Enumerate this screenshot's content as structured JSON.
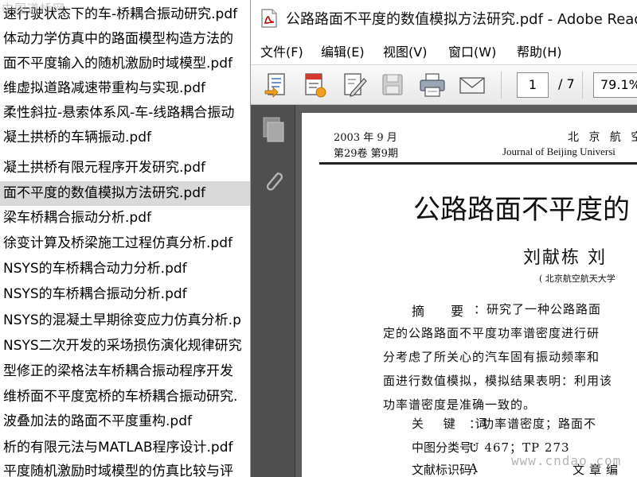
{
  "watermark_top_left": "中国道桥网",
  "watermark_bottom_right": "www.cndao.com",
  "file_list": {
    "items": [
      "速行驶状态下的车-桥耦合振动研究.pdf",
      "体动力学仿真中的路面模型构造方法的",
      "面不平度输入的随机激励时域模型.pdf",
      "维虚拟道路减速带重构与实现.pdf",
      "柔性斜拉-悬索体系风-车-线路耦合振动",
      "凝土拱桥的车辆振动.pdf",
      "凝土拱桥有限元程序开发研究.pdf",
      "面不平度的数值模拟方法研究.pdf",
      "梁车桥耦合振动分析.pdf",
      "徐变计算及桥梁施工过程仿真分析.pdf",
      "NSYS的车桥耦合动力分析.pdf",
      "NSYS的车桥耦合振动分析.pdf",
      "NSYS的混凝土早期徐变应力仿真分析.p",
      "NSYS二次开发的采场损伤演化规律研究",
      "型修正的梁格法车桥耦合振动程序开发",
      "维桥面不平度宽桥的车桥耦合振动研究.",
      "波叠加法的路面不平度重构.pdf",
      "析的有限元法与MATLAB程序设计.pdf",
      "平度随机激励时域模型的仿真比较与评"
    ],
    "selected_index": 7
  },
  "window": {
    "title": "公路路面不平度的数值模拟方法研究.pdf - Adobe Reader"
  },
  "menu": {
    "items": [
      "文件(F)",
      "编辑(E)",
      "视图(V)",
      "窗口(W)",
      "帮助(H)"
    ]
  },
  "toolbar": {
    "current_page": "1",
    "total_pages": "/ 7",
    "zoom": "79.1%"
  },
  "document": {
    "header_date": "2003 年    9 月",
    "header_volume": "第29卷 第9期",
    "header_journal_cn": "北 京 航 空",
    "header_journal_en": "Journal of Beijing Universi",
    "title": "公路路面不平度的",
    "authors": "刘献栋      刘",
    "affiliation": "( 北京航空航天大学",
    "abstract_label": "摘  要",
    "abstract_lines": [
      "：研究了一种公路路面",
      "定的公路路面不平度功率谱密度进行研",
      "分考虑了所关心的汽车固有振动频率和",
      "面进行数值模拟，模拟结果表明：利用该",
      "功率谱密度是准确一致的。"
    ],
    "keywords_label": "关 键 词",
    "keywords": "：功率谱密度；路面不",
    "clc_label": "中图分类号：",
    "clc": "U 467；TP 273",
    "doccode_label": "文献标识码：",
    "doccode": "A",
    "article_no": "文章编"
  }
}
